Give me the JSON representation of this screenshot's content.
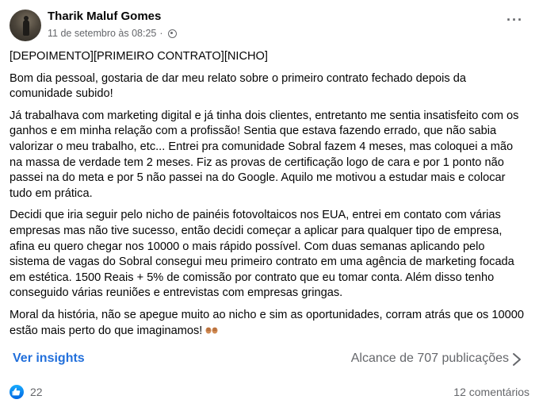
{
  "post": {
    "author": "Tharik Maluf Gomes",
    "timestamp": "11 de setembro às 08:25",
    "separator": "·",
    "privacy_icon": "globe-icon",
    "more_icon": "more-options-icon",
    "more_label": "···",
    "paragraphs": [
      "[DEPOIMENTO][PRIMEIRO CONTRATO][NICHO]",
      "Bom dia pessoal, gostaria de dar meu relato sobre o primeiro contrato fechado depois da comunidade subido!",
      "Já trabalhava com marketing digital e já tinha dois clientes, entretanto me sentia insatisfeito com os ganhos e em minha relação com a profissão! Sentia que estava fazendo errado, que não sabia valorizar o meu trabalho, etc... Entrei pra comunidade Sobral fazem 4 meses, mas coloquei a mão na massa de verdade tem 2 meses. Fiz as provas de certificação logo de cara e por 1 ponto não passei na do meta e por 5 não passei na do Google. Aquilo me motivou a estudar mais e colocar tudo em prática.",
      "Decidi que iria seguir pelo nicho de painéis fotovoltaicos nos EUA, entrei em contato com várias empresas mas não tive sucesso, então decidi começar a aplicar para qualquer tipo de empresa, afina eu quero chegar nos 10000 o mais rápido possível. Com duas semanas aplicando pelo sistema de vagas do Sobral consegui meu primeiro contrato em uma agência de marketing focada em estética. 1500 Reais + 5% de comissão por contrato que eu tomar conta. Além disso tenho conseguido várias reuniões e entrevistas com empresas gringas."
    ],
    "closing_paragraph": "Moral da história, não se apegue muito ao nicho e sim as oportunidades, corram atrás que os 10000 estão mais perto do que imaginamos!",
    "closing_emoji": "fist-bump-emoji"
  },
  "insights": {
    "link_label": "Ver insights",
    "reach_label": "Alcance de 707 publicações",
    "chevron_icon": "chevron-right-icon"
  },
  "footer": {
    "like_icon": "like-icon",
    "like_count": "22",
    "comments_label": "12 comentários"
  },
  "colors": {
    "link_blue": "#216fdb",
    "secondary_text": "#65676b",
    "like_blue": "#0866ff"
  }
}
